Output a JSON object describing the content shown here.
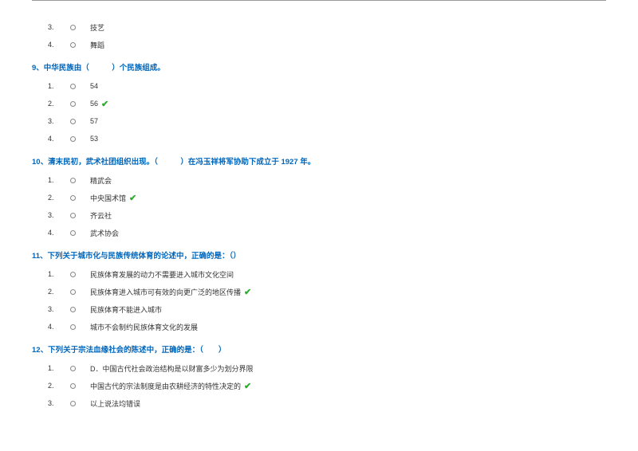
{
  "prev_options": [
    {
      "n": "3.",
      "label": "技艺"
    },
    {
      "n": "4.",
      "label": "舞蹈"
    }
  ],
  "q9": {
    "title": "9、中华民族由（　　　）个民族组成。",
    "options": [
      {
        "n": "1.",
        "label": "54",
        "correct": false
      },
      {
        "n": "2.",
        "label": "56",
        "correct": true
      },
      {
        "n": "3.",
        "label": "57",
        "correct": false
      },
      {
        "n": "4.",
        "label": "53",
        "correct": false
      }
    ]
  },
  "q10": {
    "title": "10、清末民初，武术社团组织出现。（　　　）在冯玉祥将军协助下成立于 1927 年。",
    "options": [
      {
        "n": "1.",
        "label": "精武会",
        "correct": false
      },
      {
        "n": "2.",
        "label": "中央国术馆",
        "correct": true
      },
      {
        "n": "3.",
        "label": "齐云社",
        "correct": false
      },
      {
        "n": "4.",
        "label": "武术协会",
        "correct": false
      }
    ]
  },
  "q11": {
    "title": "11、下列关于城市化与民族传统体育的论述中，正确的是：（）",
    "options": [
      {
        "n": "1.",
        "label": "民族体育发展的动力不需要进入城市文化空间",
        "correct": false
      },
      {
        "n": "2.",
        "label": "民族体育进入城市可有效的向更广泛的地区传播",
        "correct": true
      },
      {
        "n": "3.",
        "label": "民族体育不能进入城市",
        "correct": false
      },
      {
        "n": "4.",
        "label": "城市不会制约民族体育文化的发展",
        "correct": false
      }
    ]
  },
  "q12": {
    "title": "12、下列关于宗法血缘社会的陈述中，正确的是：（　　）",
    "options": [
      {
        "n": "1.",
        "label": "D．中国古代社会政治结构是以财富多少为划分界限",
        "correct": false
      },
      {
        "n": "2.",
        "label": "中国古代的宗法制度是由农耕经济的特性决定的",
        "correct": true
      },
      {
        "n": "3.",
        "label": "以上说法均错误",
        "correct": false
      }
    ]
  }
}
